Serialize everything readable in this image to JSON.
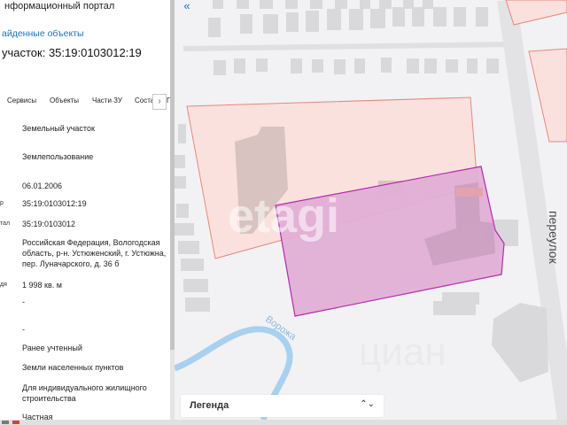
{
  "panel": {
    "portal_title": "нформационный портал",
    "found_objects": "айденные объекты",
    "parcel_title": "участок: 35:19:0103012:19",
    "tabs": [
      "Сервисы",
      "Объекты",
      "Части ЗУ",
      "Соста"
    ],
    "tab_next": "›",
    "rows": [
      {
        "frag": "",
        "value": "Земельный участок"
      },
      {
        "frag": "",
        "value": "Землепользование"
      },
      {
        "frag": "",
        "value": "06.01.2006"
      },
      {
        "frag": "р",
        "value": "35:19:0103012:19"
      },
      {
        "frag": "тал",
        "value": "35:19:0103012"
      },
      {
        "frag": "",
        "value": "Российская Федерация, Вологодская область, р-н. Устюженский, г. Устюжна, пер. Луначарского, д. 36 б"
      },
      {
        "frag": "дя",
        "value": "1 998 кв. м"
      },
      {
        "frag": "",
        "value": "-"
      },
      {
        "frag": "",
        "value": "-"
      },
      {
        "frag": "",
        "value": "Ранее учтенный"
      },
      {
        "frag": "",
        "value": "Земли населенных пунктов"
      },
      {
        "frag": "",
        "value": "Для индивидуального жилищного строительства"
      },
      {
        "frag": "",
        "value": "Частная"
      }
    ]
  },
  "map": {
    "collapse_icon": "«",
    "street_label": "переулок",
    "river_label": "Ворожа",
    "watermark_etagi": "etagi",
    "watermark_cian": "циан",
    "legend_label": "Легенда",
    "legend_chevron": "⌃⌄",
    "colors": {
      "background": "#f2f2f4",
      "building": "#d9d9dc",
      "parcel_fill": "#fbe1dd",
      "parcel_stroke": "#e5887a",
      "selected_fill": "#e2afd6",
      "selected_stroke": "#b31eb0",
      "river": "#a9d0ee"
    }
  }
}
